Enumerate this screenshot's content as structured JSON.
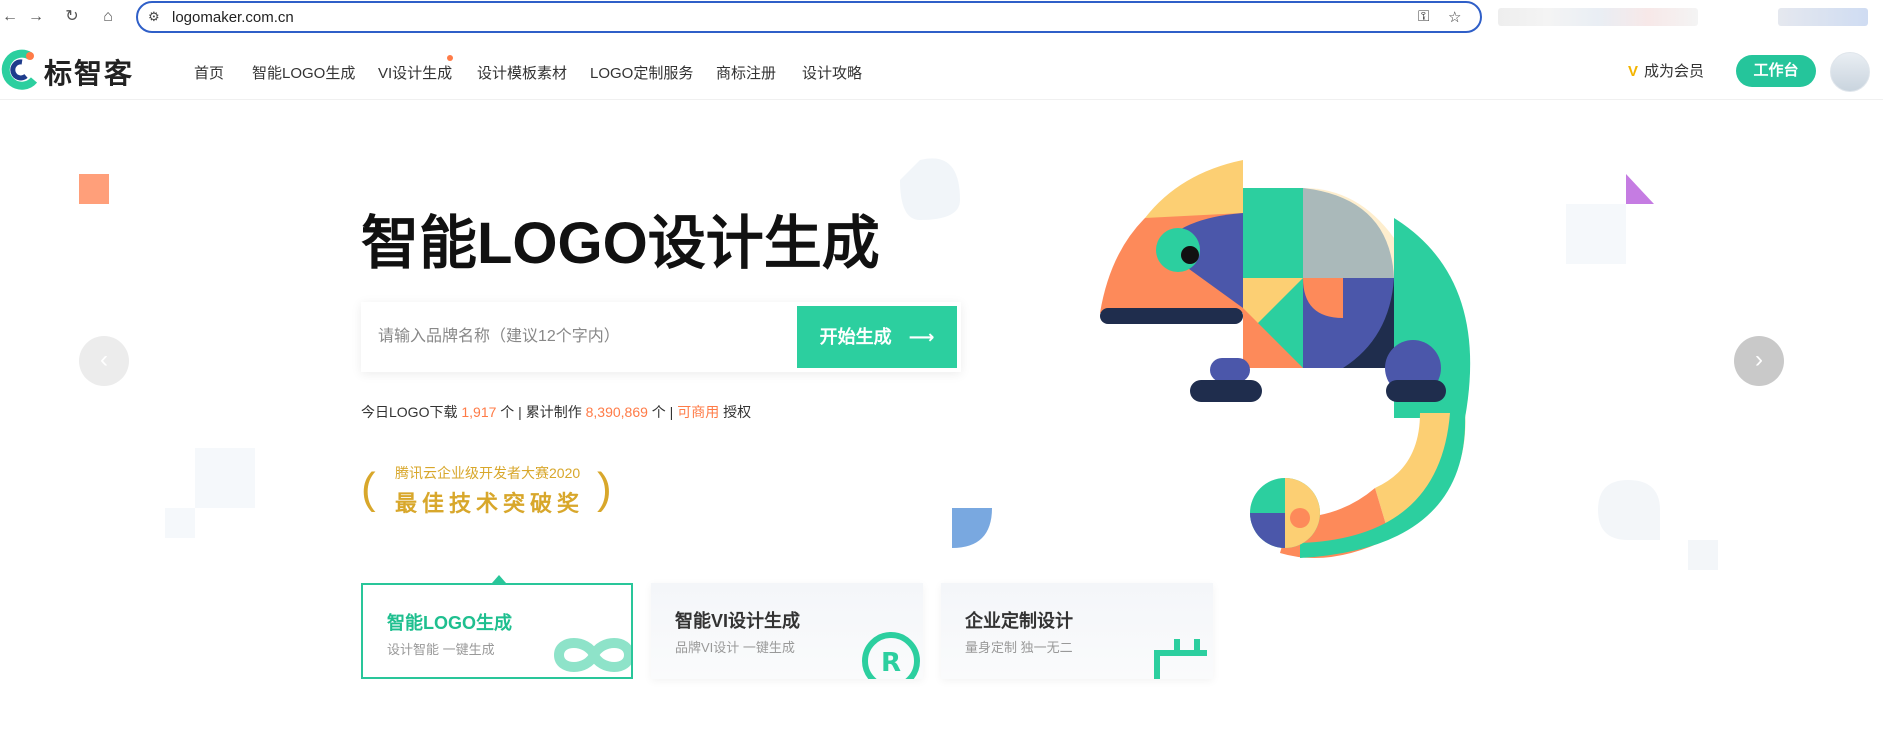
{
  "browser": {
    "url": "logomaker.com.cn"
  },
  "header": {
    "logo_text": "标智客",
    "nav": [
      "首页",
      "智能LOGO生成",
      "VI设计生成",
      "设计模板素材",
      "LOGO定制服务",
      "商标注册",
      "设计攻略"
    ],
    "member_label": "成为会员",
    "workspace_label": "工作台"
  },
  "hero": {
    "title": "智能LOGO设计生成",
    "search_placeholder": "请输入品牌名称（建议12个字内）",
    "search_button": "开始生成",
    "stats": {
      "prefix": "今日LOGO下载",
      "today_count": "1,917",
      "today_unit": "个 | 累计制作",
      "total_count": "8,390,869",
      "total_unit": "个 |",
      "commercial": "可商用",
      "license": "授权"
    },
    "award": {
      "line1": "腾讯云企业级开发者大赛2020",
      "line2": "最佳技术突破奖"
    }
  },
  "features": [
    {
      "title": "智能LOGO生成",
      "subtitle": "设计智能 一键生成",
      "active": true
    },
    {
      "title": "智能VI设计生成",
      "subtitle": "品牌VI设计 一键生成",
      "active": false
    },
    {
      "title": "企业定制设计",
      "subtitle": "量身定制 独一无二",
      "active": false
    }
  ],
  "icons": [
    "back-icon",
    "forward-icon",
    "reload-icon",
    "home-icon",
    "site-info-icon",
    "password-key-icon",
    "bookmark-star-icon",
    "chevron-left-icon",
    "chevron-right-icon"
  ],
  "colors": {
    "brand_green": "#2ccf9f",
    "accent_orange": "#ff7b47",
    "gold": "#d8a72b",
    "url_border": "#2f5fc8"
  }
}
